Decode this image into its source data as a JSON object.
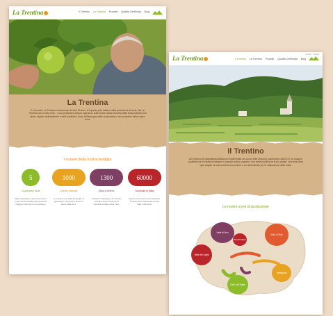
{
  "page1": {
    "logo": "La Trentina",
    "nav": [
      "Il Trentino",
      "La Trentina",
      "Prodotti",
      "Qualità Certificata",
      "Blog"
    ],
    "title": "La Trentina",
    "intro": "Il Consorzio La Trentina nel mercato da oltre 30 anni, è il quarto polo italiano nella produzione di mele. Ma La Trentina non è solo mele... i suoi produttori portano ogni anno sulle vostre tavole la bontà della frutta coltivata nel pieno rispetto dell'ambiente e delle tradizioni, frutto dell'impegno delle cooperative e dei produttori della nostra terra.",
    "stats_title": "I numeri della nostra famiglia",
    "stats": [
      {
        "value": "5",
        "label": "Cooperative socie",
        "desc": "Sigle cooperative e gerarchie in cui ci posso alcuni produttori dei membri in maggioro raccolgono con passione."
      },
      {
        "value": "1000",
        "label": "Aziende frutticole",
        "desc": "La nostra è una realtà di famiglie, di generazioni, vicinanza e amore al lavoro della terra."
      },
      {
        "value": "1300",
        "label": "Ettari di terreno",
        "desc": "Coltivati in Valsugana, nel Trentino orientale, terreni ideali per la coltivazione delle nostre mele."
      },
      {
        "value": "60000",
        "label": "Tonnellate di frutta",
        "desc": "Ogni anno la nostra mela coltivata in Trentino arriva sulle tavole di tutta Italia e d'Europa."
      }
    ]
  },
  "page2": {
    "logo": "La Trentina",
    "top_links": [
      "ricerca",
      "lingua"
    ],
    "nav": [
      "Il Trentino",
      "La Trentina",
      "Prodotti",
      "Qualità Certificata",
      "Blog"
    ],
    "title": "Il Trentino",
    "intro": "Un territorio di straordinaria bellezza e biodiversità nel cuore delle Dolomiti, patrimonio UNESCO: un luogo in equilibrio tra le tradizioni italiane e passato austro-ungarico, una meta turistica tra le più amate, una terra dove ogni angolo ha una storia da raccontare e un clima ideale per la coltivazione della frutta.",
    "map_title": "Le nostre zone di produzione",
    "regions": [
      "Valle di Non",
      "Valle di Sole",
      "Valle dei Laghi",
      "Valsugana",
      "Piana Rotaliana",
      "Valle dell'Adige"
    ]
  },
  "colors": {
    "brand_green": "#7aa327",
    "orange": "#e78b22",
    "paper": "#d6b48a",
    "stat_circles": [
      "#8cbc2a",
      "#e8a321",
      "#7e3f63",
      "#b8262c"
    ]
  }
}
